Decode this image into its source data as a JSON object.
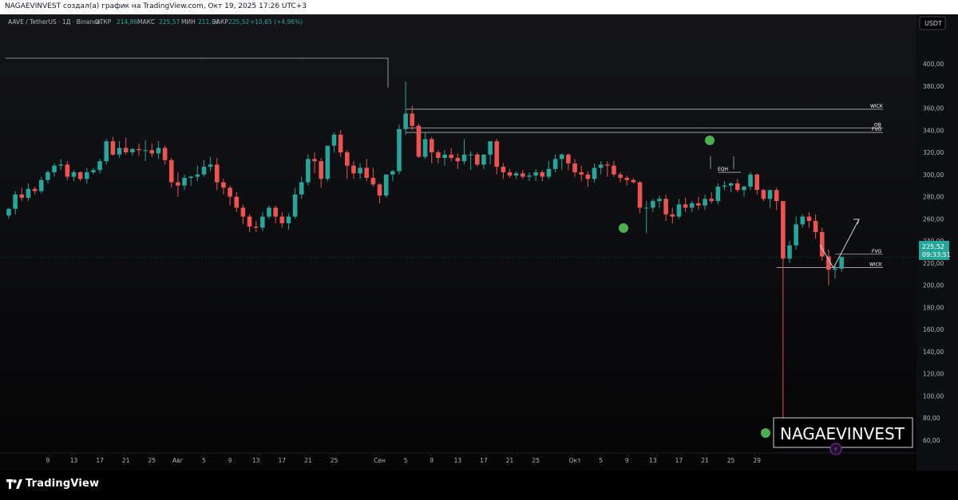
{
  "header": {
    "text": "NAGAEVINVEST создал(а) график на TradingView.com, Окт 19, 2025 17:26 UTC+3"
  },
  "footer": {
    "logo_text": "TradingView",
    "logo_icon": "tradingview-logo-icon"
  },
  "colors": {
    "background": "#0b0c10",
    "up": "#26a69a",
    "down": "#ef5350",
    "line": "#b2b5be",
    "marker": "#4caf50",
    "text": "#b2b5be",
    "price_label": "#26a69a"
  },
  "chart_data": {
    "type": "candlestick",
    "legend": {
      "symbol": "AAVE / TetherUS · 1Д · Binance",
      "open_label": "ОТКР",
      "open": "214,86",
      "high_label": "МАКС",
      "high": "225,57",
      "low_label": "МИН",
      "low": "211,64",
      "close_label": "ЗАКР",
      "close": "225,52",
      "change": "+10,65 (+4,96%)"
    },
    "currency_label": "USDT",
    "y_axis": {
      "min": 50,
      "max": 420,
      "ticks": [
        60,
        80,
        100,
        120,
        140,
        160,
        180,
        200,
        220,
        240,
        260,
        280,
        300,
        320,
        340,
        360,
        380,
        400
      ],
      "tick_labels": [
        "60,00",
        "80,00",
        "100,00",
        "120,00",
        "140,00",
        "160,00",
        "180,00",
        "200,00",
        "220,00",
        "240,00",
        "260,00",
        "280,00",
        "300,00",
        "320,00",
        "340,00",
        "360,00",
        "380,00",
        "400,00"
      ]
    },
    "x_axis": {
      "labels": [
        "9",
        "13",
        "17",
        "21",
        "25",
        "Авг",
        "5",
        "9",
        "13",
        "17",
        "21",
        "25",
        "Сен",
        "5",
        "9",
        "13",
        "17",
        "21",
        "25",
        "Окт",
        "5",
        "9",
        "13",
        "17",
        "21",
        "25",
        "29"
      ],
      "label_index": [
        6,
        10,
        14,
        18,
        22,
        26,
        30,
        34,
        38,
        42,
        46,
        50,
        57,
        61,
        65,
        69,
        73,
        77,
        81,
        87,
        91,
        95,
        99,
        103,
        107,
        111,
        115
      ]
    },
    "candles": [
      [
        0,
        263,
        270,
        260,
        269
      ],
      [
        1,
        269,
        285,
        264,
        282
      ],
      [
        2,
        282,
        288,
        276,
        279
      ],
      [
        3,
        279,
        292,
        276,
        287
      ],
      [
        4,
        287,
        289,
        282,
        285
      ],
      [
        5,
        285,
        298,
        283,
        295
      ],
      [
        6,
        295,
        304,
        292,
        302
      ],
      [
        7,
        302,
        310,
        298,
        308
      ],
      [
        8,
        308,
        314,
        304,
        309
      ],
      [
        9,
        309,
        312,
        295,
        298
      ],
      [
        10,
        298,
        304,
        294,
        302
      ],
      [
        11,
        302,
        303,
        294,
        296
      ],
      [
        12,
        296,
        306,
        292,
        302
      ],
      [
        13,
        302,
        306,
        300,
        304
      ],
      [
        14,
        304,
        314,
        301,
        312
      ],
      [
        15,
        312,
        332,
        309,
        330
      ],
      [
        16,
        330,
        334,
        317,
        318
      ],
      [
        17,
        318,
        330,
        315,
        324
      ],
      [
        18,
        324,
        333,
        318,
        320
      ],
      [
        19,
        320,
        324,
        317,
        323
      ],
      [
        20,
        323,
        328,
        317,
        322
      ],
      [
        21,
        322,
        331,
        312,
        322
      ],
      [
        22,
        322,
        328,
        316,
        319
      ],
      [
        23,
        319,
        330,
        314,
        324
      ],
      [
        24,
        324,
        326,
        309,
        313
      ],
      [
        25,
        313,
        315,
        288,
        293
      ],
      [
        26,
        293,
        302,
        280,
        290
      ],
      [
        27,
        290,
        300,
        286,
        297
      ],
      [
        28,
        297,
        299,
        290,
        298
      ],
      [
        29,
        298,
        308,
        294,
        300
      ],
      [
        30,
        300,
        313,
        298,
        307
      ],
      [
        31,
        307,
        316,
        303,
        309
      ],
      [
        32,
        309,
        315,
        286,
        293
      ],
      [
        33,
        293,
        296,
        282,
        288
      ],
      [
        34,
        288,
        290,
        272,
        280
      ],
      [
        35,
        280,
        284,
        266,
        270
      ],
      [
        36,
        270,
        273,
        255,
        262
      ],
      [
        37,
        262,
        264,
        248,
        253
      ],
      [
        38,
        253,
        258,
        248,
        252
      ],
      [
        39,
        252,
        266,
        249,
        262
      ],
      [
        40,
        262,
        272,
        260,
        270
      ],
      [
        41,
        270,
        272,
        256,
        262
      ],
      [
        42,
        262,
        266,
        252,
        256
      ],
      [
        43,
        256,
        265,
        250,
        262
      ],
      [
        44,
        262,
        288,
        260,
        282
      ],
      [
        45,
        282,
        298,
        278,
        293
      ],
      [
        46,
        293,
        318,
        290,
        314
      ],
      [
        47,
        314,
        320,
        301,
        312
      ],
      [
        48,
        312,
        315,
        288,
        296
      ],
      [
        49,
        296,
        324,
        294,
        326
      ],
      [
        50,
        326,
        338,
        320,
        336
      ],
      [
        51,
        336,
        340,
        316,
        320
      ],
      [
        52,
        320,
        322,
        296,
        308
      ],
      [
        53,
        308,
        312,
        296,
        301
      ],
      [
        54,
        301,
        310,
        296,
        306
      ],
      [
        55,
        306,
        314,
        294,
        297
      ],
      [
        56,
        297,
        306,
        289,
        291
      ],
      [
        57,
        291,
        292,
        274,
        281
      ],
      [
        58,
        281,
        300,
        279,
        300
      ],
      [
        59,
        300,
        304,
        294,
        303
      ],
      [
        60,
        303,
        345,
        300,
        341
      ],
      [
        61,
        341,
        384,
        336,
        355
      ],
      [
        62,
        355,
        362,
        340,
        344
      ],
      [
        63,
        344,
        346,
        315,
        316
      ],
      [
        64,
        316,
        338,
        314,
        332
      ],
      [
        65,
        332,
        334,
        310,
        320
      ],
      [
        66,
        320,
        322,
        310,
        315
      ],
      [
        67,
        315,
        322,
        308,
        318
      ],
      [
        68,
        318,
        324,
        312,
        315
      ],
      [
        69,
        315,
        319,
        305,
        312
      ],
      [
        70,
        312,
        332,
        309,
        318
      ],
      [
        71,
        318,
        321,
        304,
        318
      ],
      [
        72,
        318,
        320,
        307,
        309
      ],
      [
        73,
        309,
        318,
        305,
        318
      ],
      [
        74,
        318,
        330,
        309,
        330
      ],
      [
        75,
        330,
        332,
        300,
        307
      ],
      [
        76,
        307,
        310,
        296,
        302
      ],
      [
        77,
        302,
        305,
        297,
        299
      ],
      [
        78,
        299,
        303,
        296,
        301
      ],
      [
        79,
        301,
        304,
        296,
        298
      ],
      [
        80,
        298,
        302,
        294,
        299
      ],
      [
        81,
        299,
        305,
        294,
        302
      ],
      [
        82,
        302,
        304,
        294,
        298
      ],
      [
        83,
        298,
        312,
        296,
        305
      ],
      [
        84,
        305,
        318,
        302,
        314
      ],
      [
        85,
        314,
        319,
        304,
        318
      ],
      [
        86,
        318,
        319,
        304,
        310
      ],
      [
        87,
        310,
        314,
        298,
        302
      ],
      [
        88,
        302,
        308,
        294,
        300
      ],
      [
        89,
        300,
        303,
        289,
        296
      ],
      [
        90,
        296,
        310,
        293,
        306
      ],
      [
        91,
        306,
        312,
        300,
        309
      ],
      [
        92,
        309,
        312,
        298,
        308
      ],
      [
        93,
        308,
        312,
        298,
        300
      ],
      [
        94,
        300,
        302,
        293,
        297
      ],
      [
        95,
        297,
        299,
        290,
        295
      ],
      [
        96,
        295,
        297,
        292,
        293
      ],
      [
        97,
        293,
        294,
        265,
        270
      ],
      [
        98,
        270,
        276,
        247,
        270
      ],
      [
        99,
        270,
        278,
        266,
        276
      ],
      [
        100,
        276,
        281,
        270,
        278
      ],
      [
        101,
        278,
        282,
        258,
        264
      ],
      [
        102,
        264,
        270,
        256,
        262
      ],
      [
        103,
        262,
        278,
        260,
        273
      ],
      [
        104,
        273,
        279,
        266,
        270
      ],
      [
        105,
        270,
        276,
        266,
        274
      ],
      [
        106,
        274,
        280,
        268,
        272
      ],
      [
        107,
        272,
        282,
        268,
        278
      ],
      [
        108,
        278,
        284,
        274,
        276
      ],
      [
        109,
        276,
        292,
        273,
        289
      ],
      [
        110,
        289,
        294,
        286,
        290
      ],
      [
        111,
        290,
        293,
        284,
        292
      ],
      [
        112,
        292,
        296,
        284,
        286
      ],
      [
        113,
        286,
        290,
        280,
        289
      ],
      [
        114,
        289,
        302,
        286,
        300
      ],
      [
        115,
        300,
        301,
        282,
        286
      ],
      [
        116,
        286,
        287,
        276,
        278
      ],
      [
        117,
        278,
        286,
        270,
        286
      ],
      [
        118,
        286,
        288,
        268,
        276
      ],
      [
        119,
        276,
        276,
        75,
        224
      ],
      [
        120,
        224,
        240,
        220,
        236
      ],
      [
        121,
        236,
        262,
        232,
        255
      ],
      [
        122,
        255,
        264,
        252,
        262
      ],
      [
        123,
        262,
        266,
        252,
        258
      ],
      [
        124,
        258,
        264,
        242,
        248
      ],
      [
        125,
        248,
        252,
        222,
        226
      ],
      [
        126,
        226,
        232,
        200,
        214
      ],
      [
        127,
        214,
        218,
        206,
        215
      ],
      [
        128,
        215,
        226,
        212,
        225.5
      ]
    ],
    "horizontal_levels": [
      {
        "name": "WICK",
        "value": 359
      },
      {
        "name": "OB",
        "value": 342
      },
      {
        "name": "FVG",
        "value": 338
      },
      {
        "name": "FVG",
        "value": 228
      },
      {
        "name": "WICK",
        "value": 216
      },
      {
        "name": "EQH",
        "value": 302
      }
    ],
    "annotations": [
      "WICK",
      "OB",
      "FVG",
      "EQH",
      "FVG",
      "WICK"
    ],
    "price_label": {
      "price": "225,52",
      "countdown": "09:33:51"
    },
    "watermark": "NAGAEVINVEST"
  }
}
